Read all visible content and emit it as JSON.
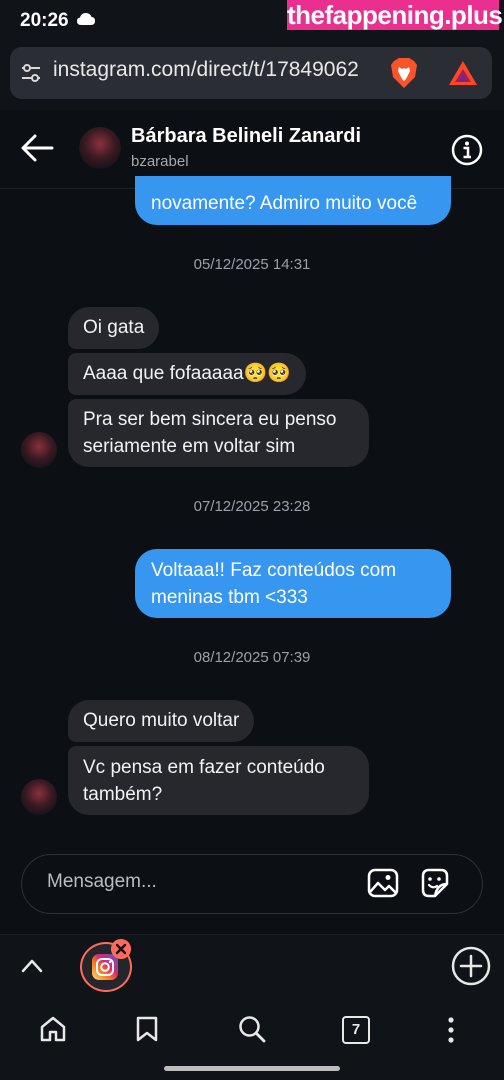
{
  "status_bar": {
    "time": "20:26"
  },
  "watermark": "thefappening.plus",
  "browser": {
    "url": "instagram.com/direct/t/17849062",
    "tab_count": "7"
  },
  "chat": {
    "contact_name": "Bárbara Belineli Zanardi",
    "contact_username": "bzarabel"
  },
  "messages": {
    "out_0": "novamente? Admiro muito você",
    "ts_1": "05/12/2025 14:31",
    "in_1": "Oi gata",
    "in_2": "Aaaa que fofaaaaa🥺🥺",
    "in_3_line1": "Pra ser bem sincera eu penso",
    "in_3_line2": "seriamente em voltar sim",
    "ts_2": "07/12/2025 23:28",
    "out_1_line1": "Voltaaa!! Faz conteúdos com",
    "out_1_line2": "meninas tbm <333",
    "ts_3": "08/12/2025 07:39",
    "in_4": "Quero muito voltar",
    "in_5_line1": "Vc pensa em fazer conteúdo",
    "in_5_line2": "também?"
  },
  "composer": {
    "placeholder": "Mensagem..."
  },
  "colors": {
    "outgoing": "#3797f0",
    "incoming": "#26282e",
    "background": "#0c0f14"
  }
}
